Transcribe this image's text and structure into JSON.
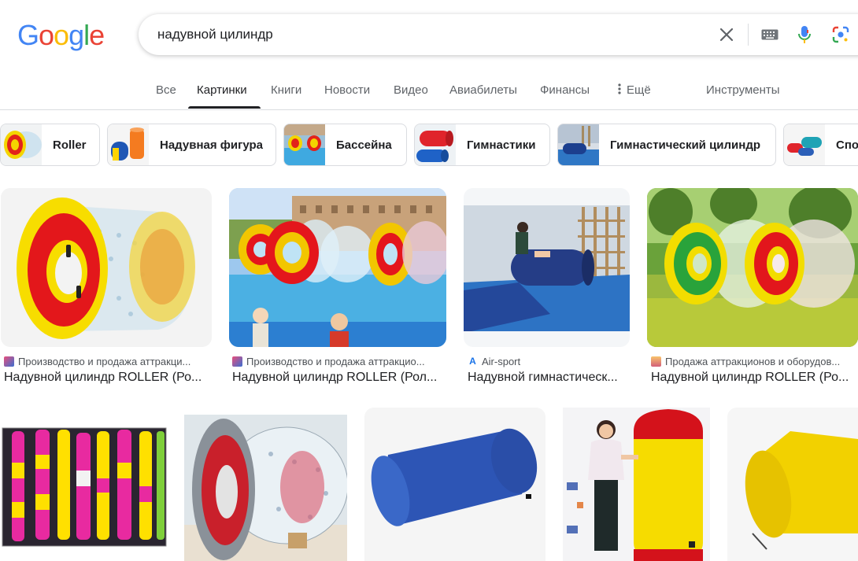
{
  "header": {
    "logo_letters": [
      {
        "char": "G",
        "color": "#4285F4"
      },
      {
        "char": "o",
        "color": "#EA4335"
      },
      {
        "char": "o",
        "color": "#FBBC05"
      },
      {
        "char": "g",
        "color": "#4285F4"
      },
      {
        "char": "l",
        "color": "#34A853"
      },
      {
        "char": "e",
        "color": "#EA4335"
      }
    ],
    "search": {
      "query": "надувной цилиндр",
      "icons": [
        "clear-icon",
        "keyboard-icon",
        "microphone-icon",
        "lens-icon"
      ]
    }
  },
  "tabs": [
    {
      "label": "Все",
      "active": false
    },
    {
      "label": "Картинки",
      "active": true
    },
    {
      "label": "Книги",
      "active": false
    },
    {
      "label": "Новости",
      "active": false
    },
    {
      "label": "Видео",
      "active": false
    },
    {
      "label": "Авиабилеты",
      "active": false
    },
    {
      "label": "Финансы",
      "active": false
    },
    {
      "label": "Ещё",
      "active": false,
      "icon": "more-vert-icon"
    },
    {
      "label": "Инструменты",
      "active": false
    }
  ],
  "chips": [
    {
      "label": "Roller"
    },
    {
      "label": "Надувная фигура"
    },
    {
      "label": "Бассейна"
    },
    {
      "label": "Гимнастики"
    },
    {
      "label": "Гимнастический цилиндр"
    },
    {
      "label": "Спо"
    }
  ],
  "results_row1": [
    {
      "source": "Производство и продажа аттракци...",
      "title": "Надувной цилиндр ROLLER (Ро..."
    },
    {
      "source": "Производство и продажа аттракцио...",
      "title": "Надувной цилиндр ROLLER (Рол..."
    },
    {
      "source": "Air-sport",
      "title": "Надувной гимнастическ..."
    },
    {
      "source": "Продажа аттракционов и оборудов...",
      "title": "Надувной цилиндр ROLLER (Ро..."
    }
  ],
  "results_row2": [
    {
      "name": "inflatable-columns"
    },
    {
      "name": "transparent-roller"
    },
    {
      "name": "blue-cylinder"
    },
    {
      "name": "woman-with-yellow-cylinder"
    },
    {
      "name": "yellow-cylinder"
    }
  ],
  "colors": {
    "accent_blue": "#1a73e8",
    "text_primary": "#202124",
    "text_secondary": "#4d5156",
    "divider": "#dadce0"
  }
}
